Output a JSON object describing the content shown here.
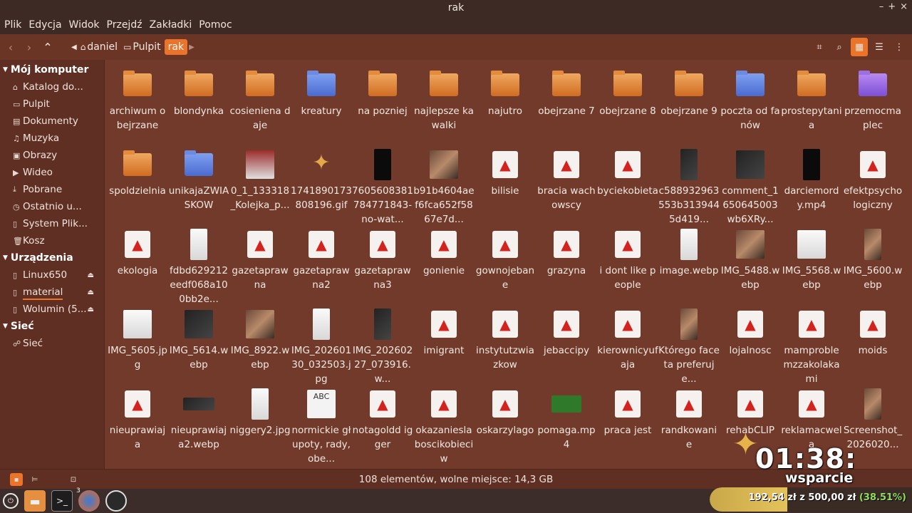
{
  "window": {
    "title": "rak"
  },
  "menubar": [
    "Plik",
    "Edycja",
    "Widok",
    "Przejdź",
    "Zakładki",
    "Pomoc"
  ],
  "breadcrumbs": [
    {
      "label": "daniel",
      "icon": "home-icon"
    },
    {
      "label": "Pulpit",
      "icon": "folder-icon"
    },
    {
      "label": "rak",
      "icon": ""
    }
  ],
  "sidebar": {
    "sections": [
      {
        "title": "Mój komputer",
        "items": [
          {
            "label": "Katalog do...",
            "icon": "home-icon"
          },
          {
            "label": "Pulpit",
            "icon": "desktop-icon"
          },
          {
            "label": "Dokumenty",
            "icon": "document-icon"
          },
          {
            "label": "Muzyka",
            "icon": "music-icon"
          },
          {
            "label": "Obrazy",
            "icon": "image-icon"
          },
          {
            "label": "Wideo",
            "icon": "video-icon"
          },
          {
            "label": "Pobrane",
            "icon": "download-icon"
          },
          {
            "label": "Ostatnio u...",
            "icon": "clock-icon"
          },
          {
            "label": "System Plik...",
            "icon": "drive-icon"
          },
          {
            "label": "Kosz",
            "icon": "trash-icon"
          }
        ]
      },
      {
        "title": "Urządzenia",
        "items": [
          {
            "label": "Linux650",
            "icon": "drive-icon",
            "eject": true
          },
          {
            "label": "material",
            "icon": "drive-icon",
            "eject": true,
            "usage": 0.62
          },
          {
            "label": "Wolumin (5...",
            "icon": "drive-icon",
            "eject": true
          }
        ]
      },
      {
        "title": "Sieć",
        "items": [
          {
            "label": "Sieć",
            "icon": "network-icon"
          }
        ]
      }
    ]
  },
  "files": [
    {
      "name": "archiwum obejrzane",
      "kind": "folder"
    },
    {
      "name": "blondynka",
      "kind": "folder"
    },
    {
      "name": "cosieniena daje",
      "kind": "folder"
    },
    {
      "name": "kreatury",
      "kind": "folder-blue"
    },
    {
      "name": "na pozniej",
      "kind": "folder"
    },
    {
      "name": "najlepsze kawalki",
      "kind": "folder"
    },
    {
      "name": "najutro",
      "kind": "folder"
    },
    {
      "name": "obejrzane 7",
      "kind": "folder"
    },
    {
      "name": "obejrzane 8",
      "kind": "folder"
    },
    {
      "name": "obejrzane 9",
      "kind": "folder"
    },
    {
      "name": "poczta od fanów",
      "kind": "folder-blue"
    },
    {
      "name": "prostepytania",
      "kind": "folder"
    },
    {
      "name": "przemocmaplec",
      "kind": "folder-purple"
    },
    {
      "name": "spoldzielnia",
      "kind": "folder"
    },
    {
      "name": "unikajaZWIASKOW",
      "kind": "folder-blue"
    },
    {
      "name": "0_1_133318_Kolejka_p...",
      "kind": "thumb-red"
    },
    {
      "name": "1741890173808196.gif",
      "kind": "thumb-gif"
    },
    {
      "name": "7605608381784771843-no-wat...",
      "kind": "thumb-black-tall"
    },
    {
      "name": "b91b4604aef6fca652f5867e7d...",
      "kind": "thumb-photo"
    },
    {
      "name": "bilisie",
      "kind": "doc"
    },
    {
      "name": "bracia wachowscy",
      "kind": "doc"
    },
    {
      "name": "byciekobieta",
      "kind": "doc"
    },
    {
      "name": "c588932963553b3139445d419...",
      "kind": "thumb-dark-tall"
    },
    {
      "name": "comment_1650645003wb6XRy...",
      "kind": "thumb-dark"
    },
    {
      "name": "darciemordy.mp4",
      "kind": "thumb-black-tall"
    },
    {
      "name": "efektpsychologiczny",
      "kind": "doc"
    },
    {
      "name": "ekologia",
      "kind": "doc"
    },
    {
      "name": "fdbd629212eedf068a100bb2e...",
      "kind": "thumb-paper-tall"
    },
    {
      "name": "gazetaprawna",
      "kind": "doc"
    },
    {
      "name": "gazetaprawna2",
      "kind": "doc"
    },
    {
      "name": "gazetaprawna3",
      "kind": "doc"
    },
    {
      "name": "gonienie",
      "kind": "doc"
    },
    {
      "name": "gownojebane",
      "kind": "doc"
    },
    {
      "name": "grazyna",
      "kind": "doc"
    },
    {
      "name": "i dont like people",
      "kind": "doc"
    },
    {
      "name": "image.webp",
      "kind": "thumb-paper-tall"
    },
    {
      "name": "IMG_5488.webp",
      "kind": "thumb-photo"
    },
    {
      "name": "IMG_5568.webp",
      "kind": "thumb-paper"
    },
    {
      "name": "IMG_5600.webp",
      "kind": "thumb-photo-tall"
    },
    {
      "name": "IMG_5605.jpg",
      "kind": "thumb-paper"
    },
    {
      "name": "IMG_5614.webp",
      "kind": "thumb-dark"
    },
    {
      "name": "IMG_8922.webp",
      "kind": "thumb-photo"
    },
    {
      "name": "IMG_20260130_032503.jpg",
      "kind": "thumb-paper-tall"
    },
    {
      "name": "IMG_20260227_073916.w...",
      "kind": "thumb-dark-tall"
    },
    {
      "name": "imigrant",
      "kind": "doc"
    },
    {
      "name": "instytutzwiazkow",
      "kind": "doc"
    },
    {
      "name": "jebaccipy",
      "kind": "doc"
    },
    {
      "name": "kierownicyufaja",
      "kind": "doc"
    },
    {
      "name": "Którego faceta preferuje...",
      "kind": "thumb-photo-tall"
    },
    {
      "name": "lojalnosc",
      "kind": "doc"
    },
    {
      "name": "mamproblemzzakolakami",
      "kind": "doc"
    },
    {
      "name": "moids",
      "kind": "doc"
    },
    {
      "name": "nieuprawiaja",
      "kind": "doc"
    },
    {
      "name": "nieuprawiaja2.webp",
      "kind": "thumb-dark-wide"
    },
    {
      "name": "niggery2.jpg",
      "kind": "thumb-paper-tall"
    },
    {
      "name": "normickie głupoty, rady, obe...",
      "kind": "thumb-abc"
    },
    {
      "name": "notagoldd igger",
      "kind": "doc"
    },
    {
      "name": "okazanieslaboscikobieciw",
      "kind": "doc"
    },
    {
      "name": "oskarzylago",
      "kind": "doc"
    },
    {
      "name": "pomaga.mp4",
      "kind": "thumb-green"
    },
    {
      "name": "praca jest",
      "kind": "doc"
    },
    {
      "name": "randkowanie",
      "kind": "doc"
    },
    {
      "name": "rehabCLIP",
      "kind": "doc"
    },
    {
      "name": "reklamacwela",
      "kind": "doc"
    },
    {
      "name": "Screenshot_2026020...",
      "kind": "thumb-photo-tall"
    }
  ],
  "status": {
    "text": "108 elementów, wolne miejsce: 14,3 GB"
  },
  "taskbar": {
    "badge": "3"
  },
  "overlay": {
    "time": "01:38:",
    "support": "wsparcie",
    "goal_text": "192,54 zł z 500,00 zł",
    "goal_pct": "(38.51%)",
    "goal_fraction": 0.3851,
    "accent": "#e9742a"
  }
}
